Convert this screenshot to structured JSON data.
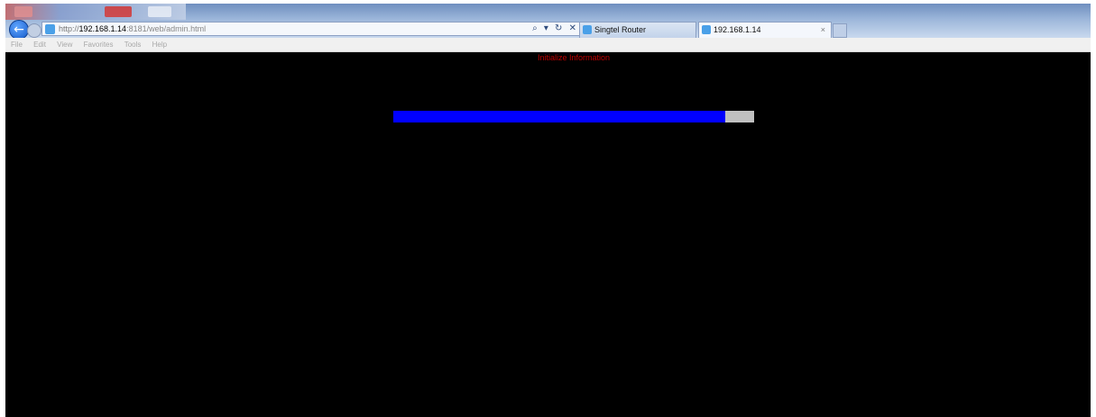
{
  "browser": {
    "address_prefix": "http://",
    "address_host": "192.168.1.14",
    "address_rest": ":8181/web/admin.html",
    "address_icons": "⌕ ▾ ↻ ✕",
    "tabs": [
      {
        "label": "Singtel Router",
        "active": false
      },
      {
        "label": "192.168.1.14",
        "active": true,
        "close": "×"
      }
    ],
    "menu": [
      "File",
      "Edit",
      "View",
      "Favorites",
      "Tools",
      "Help"
    ]
  },
  "page": {
    "heading": "Initialize Information",
    "progress": {
      "fraction": 0.92,
      "fill_color": "#0000ff",
      "track_color": "#c0c0c0"
    }
  },
  "colors": {
    "background": "#000000",
    "heading": "#c00000"
  }
}
